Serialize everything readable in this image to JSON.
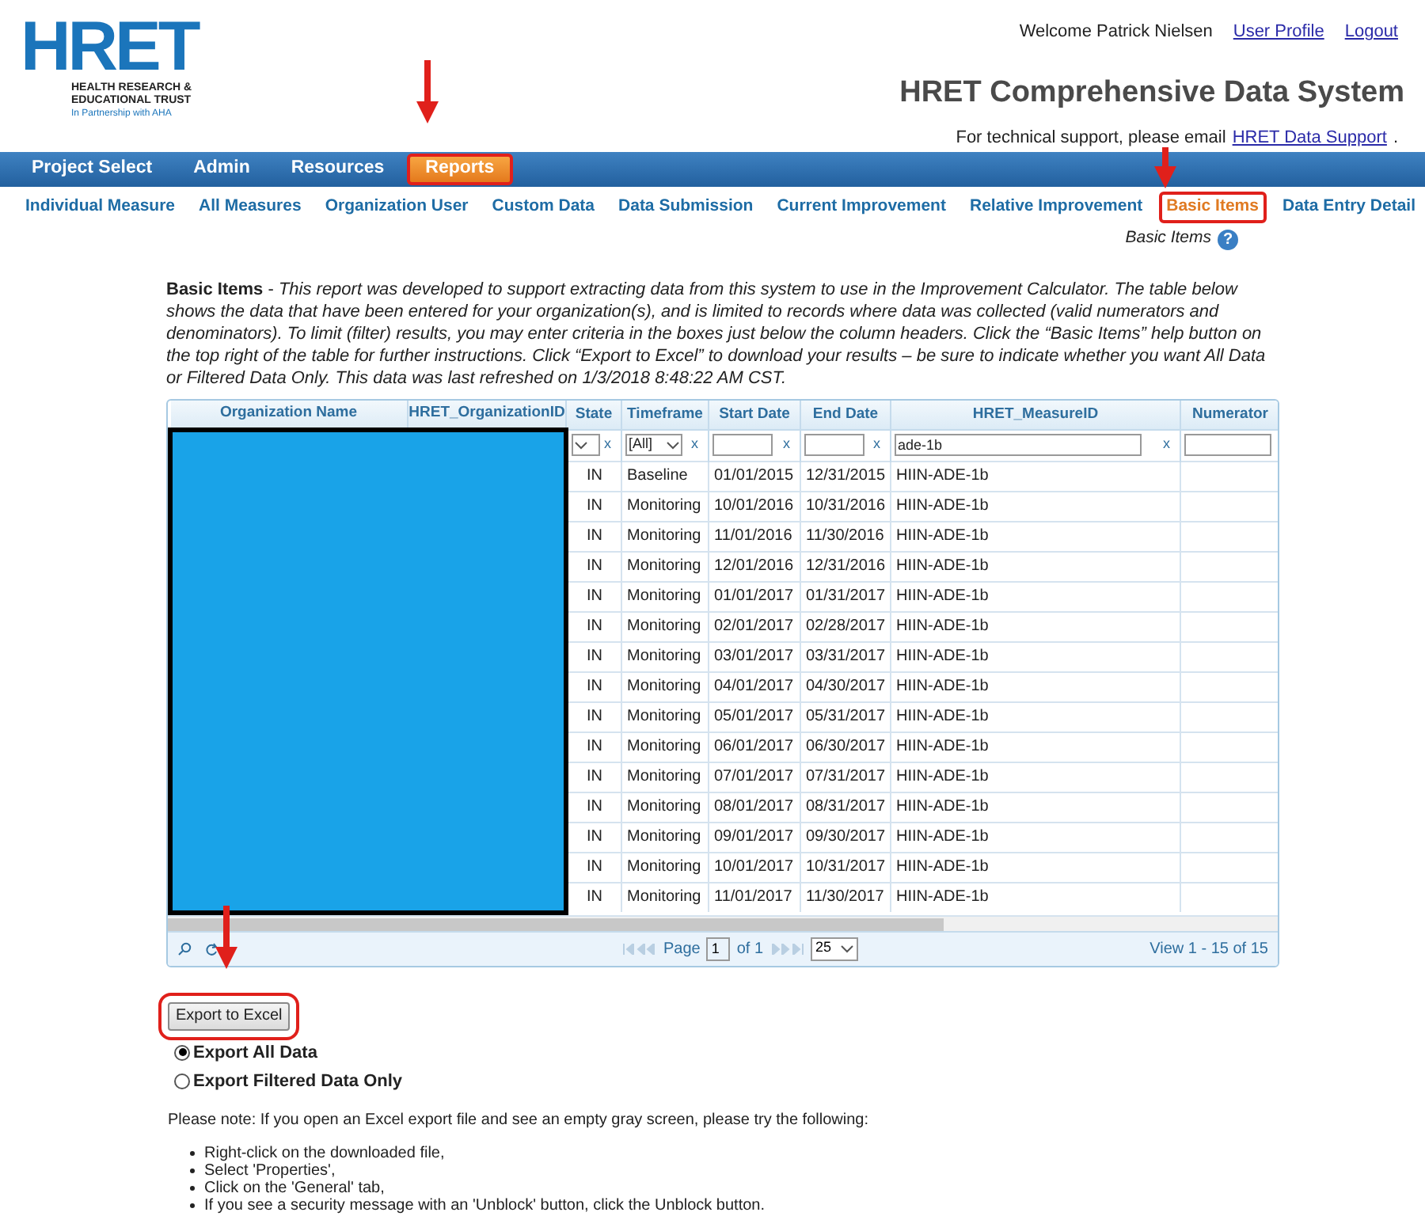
{
  "logo": {
    "mark": "HRET",
    "lines": [
      "HEALTH RESEARCH &",
      "EDUCATIONAL TRUST"
    ],
    "tagline": "In Partnership with AHA"
  },
  "user_bar": {
    "welcome": "Welcome Patrick Nielsen",
    "links": [
      "User Profile",
      "Logout"
    ]
  },
  "title": "HRET Comprehensive Data System",
  "support": {
    "text": "For technical support, please email",
    "link": "HRET Data Support",
    "suffix": "."
  },
  "nav": [
    {
      "label": "Project Select",
      "selected": false,
      "highlighted": false
    },
    {
      "label": "Admin",
      "selected": false,
      "highlighted": false
    },
    {
      "label": "Resources",
      "selected": false,
      "highlighted": false
    },
    {
      "label": "Reports",
      "selected": true,
      "highlighted": true
    }
  ],
  "subnav": [
    {
      "label": "Individual Measure",
      "selected": false,
      "highlighted": false
    },
    {
      "label": "All Measures",
      "selected": false,
      "highlighted": false
    },
    {
      "label": "Organization User",
      "selected": false,
      "highlighted": false
    },
    {
      "label": "Custom Data",
      "selected": false,
      "highlighted": false
    },
    {
      "label": "Data Submission",
      "selected": false,
      "highlighted": false
    },
    {
      "label": "Current Improvement",
      "selected": false,
      "highlighted": false
    },
    {
      "label": "Relative Improvement",
      "selected": false,
      "highlighted": false
    },
    {
      "label": "Basic Items",
      "selected": true,
      "highlighted": true
    },
    {
      "label": "Data Entry Detail",
      "selected": false,
      "highlighted": false
    }
  ],
  "help": {
    "label": "Basic Items",
    "icon": "?"
  },
  "intro": "**Basic Items** - *This report was developed to support extracting data from this system to use in the Improvement Calculator. The table below shows the data that have been entered for your organization(s), and is limited to records where data was collected (valid numerators and denominators). To limit (filter) results, you may enter criteria in the boxes just below the column headers. Click the “Basic Items” help button on the top right of the table for further instructions. Click “Export to Excel” to download your results – be sure to indicate whether you want All Data or Filtered Data Only. This data was last refreshed on 1/3/2018 8:48:22 AM CST.*",
  "table": {
    "columns": [
      "Organization Name",
      "HRET_OrganizationID",
      "State",
      "Timeframe",
      "Start Date",
      "End Date",
      "HRET_MeasureID",
      "Numerator"
    ],
    "filters": [
      {
        "kind": "select",
        "clear": "x"
      },
      {
        "kind": "select",
        "value": "[All]",
        "clear": "x"
      },
      {
        "kind": "input",
        "clear": "x"
      },
      {
        "kind": "input",
        "clear": "x"
      },
      {
        "kind": "input",
        "value": "ade-1b",
        "clear": "x"
      },
      {
        "kind": "input"
      }
    ],
    "redacted": true,
    "rows": [
      [
        "",
        "",
        "IN",
        "Baseline",
        "01/01/2015",
        "12/31/2015",
        "HIIN-ADE-1b",
        ""
      ],
      [
        "",
        "",
        "IN",
        "Monitoring",
        "10/01/2016",
        "10/31/2016",
        "HIIN-ADE-1b",
        ""
      ],
      [
        "",
        "",
        "IN",
        "Monitoring",
        "11/01/2016",
        "11/30/2016",
        "HIIN-ADE-1b",
        ""
      ],
      [
        "",
        "",
        "IN",
        "Monitoring",
        "12/01/2016",
        "12/31/2016",
        "HIIN-ADE-1b",
        ""
      ],
      [
        "",
        "",
        "IN",
        "Monitoring",
        "01/01/2017",
        "01/31/2017",
        "HIIN-ADE-1b",
        ""
      ],
      [
        "",
        "",
        "IN",
        "Monitoring",
        "02/01/2017",
        "02/28/2017",
        "HIIN-ADE-1b",
        ""
      ],
      [
        "",
        "",
        "IN",
        "Monitoring",
        "03/01/2017",
        "03/31/2017",
        "HIIN-ADE-1b",
        ""
      ],
      [
        "",
        "",
        "IN",
        "Monitoring",
        "04/01/2017",
        "04/30/2017",
        "HIIN-ADE-1b",
        ""
      ],
      [
        "",
        "",
        "IN",
        "Monitoring",
        "05/01/2017",
        "05/31/2017",
        "HIIN-ADE-1b",
        ""
      ],
      [
        "",
        "",
        "IN",
        "Monitoring",
        "06/01/2017",
        "06/30/2017",
        "HIIN-ADE-1b",
        ""
      ],
      [
        "",
        "",
        "IN",
        "Monitoring",
        "07/01/2017",
        "07/31/2017",
        "HIIN-ADE-1b",
        ""
      ],
      [
        "",
        "",
        "IN",
        "Monitoring",
        "08/01/2017",
        "08/31/2017",
        "HIIN-ADE-1b",
        ""
      ],
      [
        "",
        "",
        "IN",
        "Monitoring",
        "09/01/2017",
        "09/30/2017",
        "HIIN-ADE-1b",
        ""
      ],
      [
        "",
        "",
        "IN",
        "Monitoring",
        "10/01/2017",
        "10/31/2017",
        "HIIN-ADE-1b",
        ""
      ],
      [
        "",
        "",
        "IN",
        "Monitoring",
        "11/01/2017",
        "11/30/2017",
        "HIIN-ADE-1b",
        ""
      ]
    ],
    "pager": {
      "page_label": "Page",
      "page": "1",
      "of": "of 1",
      "page_size": "25",
      "view": "View 1 - 15 of 15"
    }
  },
  "export": {
    "button": "Export to Excel",
    "highlighted": true,
    "options": [
      {
        "label": "Export All Data",
        "selected": true
      },
      {
        "label": "Export Filtered Data Only",
        "selected": false
      }
    ]
  },
  "note": "Please note: If you open an Excel export file and see an empty gray screen, please try the following:",
  "steps": [
    "Right-click on the downloaded file,",
    "Select 'Properties',",
    "Click on the 'General' tab,",
    "If you see a security message with an 'Unblock' button, click the Unblock button."
  ]
}
